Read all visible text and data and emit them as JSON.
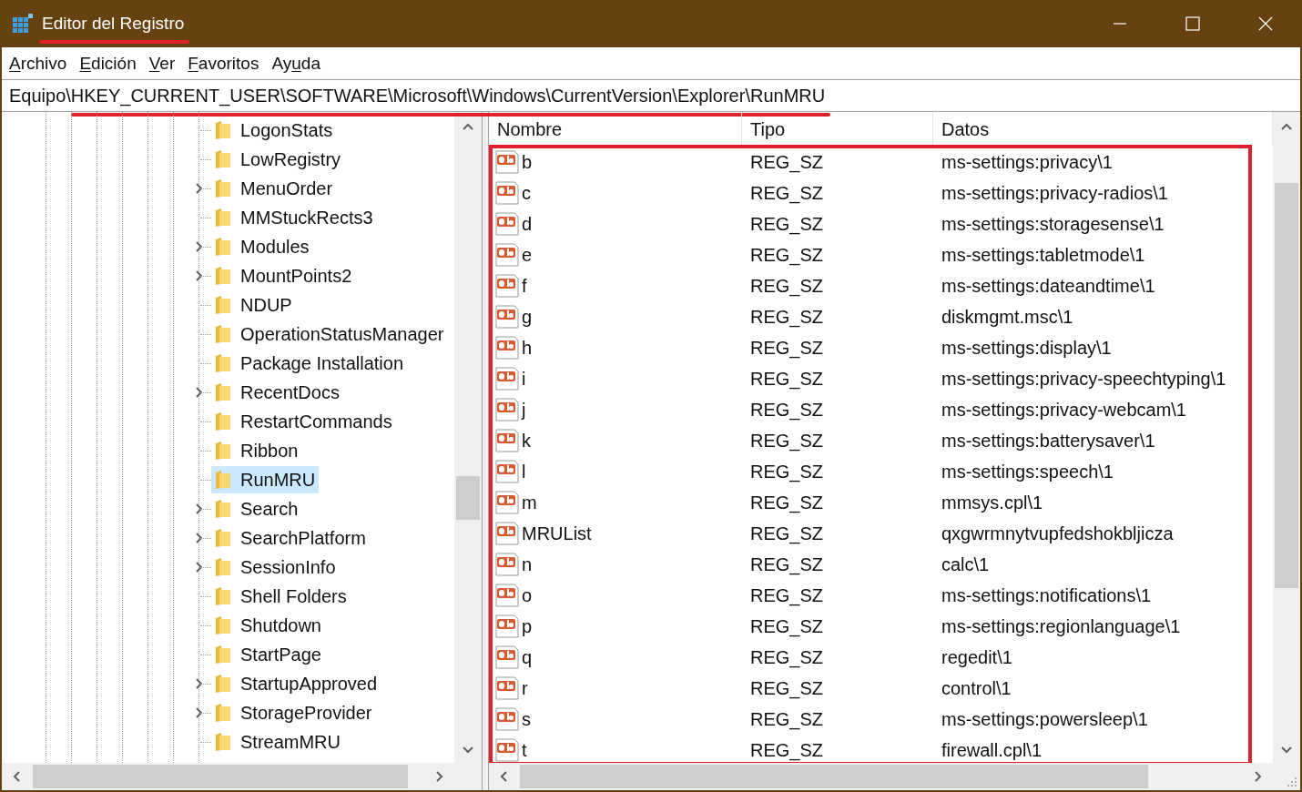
{
  "window": {
    "title": "Editor del Registro"
  },
  "menu": [
    {
      "key": "A",
      "after": "rchivo"
    },
    {
      "key": "E",
      "after": "dición"
    },
    {
      "key": "V",
      "after": "er"
    },
    {
      "key": "F",
      "after": "avoritos"
    },
    {
      "before": "Ay",
      "key": "u",
      "after": "da"
    }
  ],
  "address": "Equipo\\HKEY_CURRENT_USER\\SOFTWARE\\Microsoft\\Windows\\CurrentVersion\\Explorer\\RunMRU",
  "tree": [
    {
      "label": "LogonStats",
      "expandable": false,
      "selected": false
    },
    {
      "label": "LowRegistry",
      "expandable": false,
      "selected": false
    },
    {
      "label": "MenuOrder",
      "expandable": true,
      "selected": false
    },
    {
      "label": "MMStuckRects3",
      "expandable": false,
      "selected": false
    },
    {
      "label": "Modules",
      "expandable": true,
      "selected": false
    },
    {
      "label": "MountPoints2",
      "expandable": true,
      "selected": false
    },
    {
      "label": "NDUP",
      "expandable": false,
      "selected": false
    },
    {
      "label": "OperationStatusManager",
      "expandable": false,
      "selected": false
    },
    {
      "label": "Package Installation",
      "expandable": false,
      "selected": false
    },
    {
      "label": "RecentDocs",
      "expandable": true,
      "selected": false
    },
    {
      "label": "RestartCommands",
      "expandable": false,
      "selected": false
    },
    {
      "label": "Ribbon",
      "expandable": false,
      "selected": false
    },
    {
      "label": "RunMRU",
      "expandable": false,
      "selected": true
    },
    {
      "label": "Search",
      "expandable": true,
      "selected": false
    },
    {
      "label": "SearchPlatform",
      "expandable": true,
      "selected": false
    },
    {
      "label": "SessionInfo",
      "expandable": true,
      "selected": false
    },
    {
      "label": "Shell Folders",
      "expandable": false,
      "selected": false
    },
    {
      "label": "Shutdown",
      "expandable": false,
      "selected": false
    },
    {
      "label": "StartPage",
      "expandable": false,
      "selected": false
    },
    {
      "label": "StartupApproved",
      "expandable": true,
      "selected": false
    },
    {
      "label": "StorageProvider",
      "expandable": true,
      "selected": false
    },
    {
      "label": "StreamMRU",
      "expandable": false,
      "selected": false
    }
  ],
  "table": {
    "columns": [
      "Nombre",
      "Tipo",
      "Datos"
    ],
    "rows": [
      [
        "b",
        "REG_SZ",
        "ms-settings:privacy\\1"
      ],
      [
        "c",
        "REG_SZ",
        "ms-settings:privacy-radios\\1"
      ],
      [
        "d",
        "REG_SZ",
        "ms-settings:storagesense\\1"
      ],
      [
        "e",
        "REG_SZ",
        "ms-settings:tabletmode\\1"
      ],
      [
        "f",
        "REG_SZ",
        "ms-settings:dateandtime\\1"
      ],
      [
        "g",
        "REG_SZ",
        "diskmgmt.msc\\1"
      ],
      [
        "h",
        "REG_SZ",
        "ms-settings:display\\1"
      ],
      [
        "i",
        "REG_SZ",
        "ms-settings:privacy-speechtyping\\1"
      ],
      [
        "j",
        "REG_SZ",
        "ms-settings:privacy-webcam\\1"
      ],
      [
        "k",
        "REG_SZ",
        "ms-settings:batterysaver\\1"
      ],
      [
        "l",
        "REG_SZ",
        "ms-settings:speech\\1"
      ],
      [
        "m",
        "REG_SZ",
        "mmsys.cpl\\1"
      ],
      [
        "MRUList",
        "REG_SZ",
        "qxgwrmnytvupfedshokbljicza"
      ],
      [
        "n",
        "REG_SZ",
        "calc\\1"
      ],
      [
        "o",
        "REG_SZ",
        "ms-settings:notifications\\1"
      ],
      [
        "p",
        "REG_SZ",
        "ms-settings:regionlanguage\\1"
      ],
      [
        "q",
        "REG_SZ",
        "regedit\\1"
      ],
      [
        "r",
        "REG_SZ",
        "control\\1"
      ],
      [
        "s",
        "REG_SZ",
        "ms-settings:powersleep\\1"
      ],
      [
        "t",
        "REG_SZ",
        "firewall.cpl\\1"
      ]
    ]
  }
}
